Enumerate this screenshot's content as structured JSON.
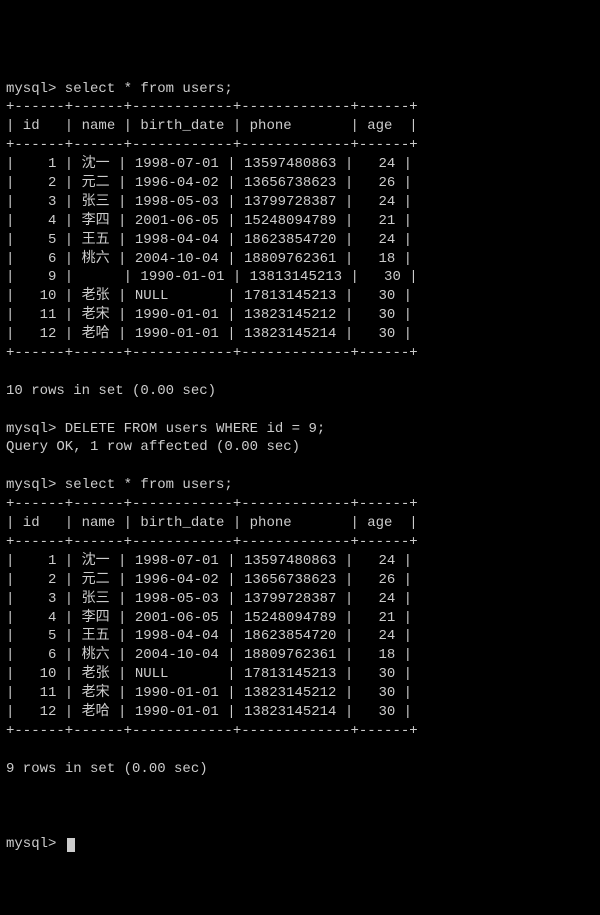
{
  "prompt": "mysql> ",
  "commands": {
    "select1": "select * from users;",
    "delete": "DELETE FROM users WHERE id = 9;",
    "select2": "select * from users;"
  },
  "responses": {
    "deleteOk": "Query OK, 1 row affected (0.00 sec)",
    "rows10": "10 rows in set (0.00 sec)",
    "rows9": "9 rows in set (0.00 sec)"
  },
  "headers": {
    "id": "id",
    "name": "name",
    "birth_date": "birth_date",
    "phone": "phone",
    "age": "age"
  },
  "border": "+------+------+------------+-------------+------+",
  "table1": {
    "rows": [
      {
        "id": "1",
        "name": "沈一",
        "birth_date": "1998-07-01",
        "phone": "13597480863",
        "age": "24"
      },
      {
        "id": "2",
        "name": "元二",
        "birth_date": "1996-04-02",
        "phone": "13656738623",
        "age": "26"
      },
      {
        "id": "3",
        "name": "张三",
        "birth_date": "1998-05-03",
        "phone": "13799728387",
        "age": "24"
      },
      {
        "id": "4",
        "name": "李四",
        "birth_date": "2001-06-05",
        "phone": "15248094789",
        "age": "21"
      },
      {
        "id": "5",
        "name": "王五",
        "birth_date": "1998-04-04",
        "phone": "18623854720",
        "age": "24"
      },
      {
        "id": "6",
        "name": "桃六",
        "birth_date": "2004-10-04",
        "phone": "18809762361",
        "age": "18"
      },
      {
        "id": "9",
        "name": "",
        "birth_date": "1990-01-01",
        "phone": "13813145213",
        "age": "30"
      },
      {
        "id": "10",
        "name": "老张",
        "birth_date": "NULL",
        "phone": "17813145213",
        "age": "30"
      },
      {
        "id": "11",
        "name": "老宋",
        "birth_date": "1990-01-01",
        "phone": "13823145212",
        "age": "30"
      },
      {
        "id": "12",
        "name": "老哈",
        "birth_date": "1990-01-01",
        "phone": "13823145214",
        "age": "30"
      }
    ]
  },
  "table2": {
    "rows": [
      {
        "id": "1",
        "name": "沈一",
        "birth_date": "1998-07-01",
        "phone": "13597480863",
        "age": "24"
      },
      {
        "id": "2",
        "name": "元二",
        "birth_date": "1996-04-02",
        "phone": "13656738623",
        "age": "26"
      },
      {
        "id": "3",
        "name": "张三",
        "birth_date": "1998-05-03",
        "phone": "13799728387",
        "age": "24"
      },
      {
        "id": "4",
        "name": "李四",
        "birth_date": "2001-06-05",
        "phone": "15248094789",
        "age": "21"
      },
      {
        "id": "5",
        "name": "王五",
        "birth_date": "1998-04-04",
        "phone": "18623854720",
        "age": "24"
      },
      {
        "id": "6",
        "name": "桃六",
        "birth_date": "2004-10-04",
        "phone": "18809762361",
        "age": "18"
      },
      {
        "id": "10",
        "name": "老张",
        "birth_date": "NULL",
        "phone": "17813145213",
        "age": "30"
      },
      {
        "id": "11",
        "name": "老宋",
        "birth_date": "1990-01-01",
        "phone": "13823145212",
        "age": "30"
      },
      {
        "id": "12",
        "name": "老哈",
        "birth_date": "1990-01-01",
        "phone": "13823145214",
        "age": "30"
      }
    ]
  }
}
